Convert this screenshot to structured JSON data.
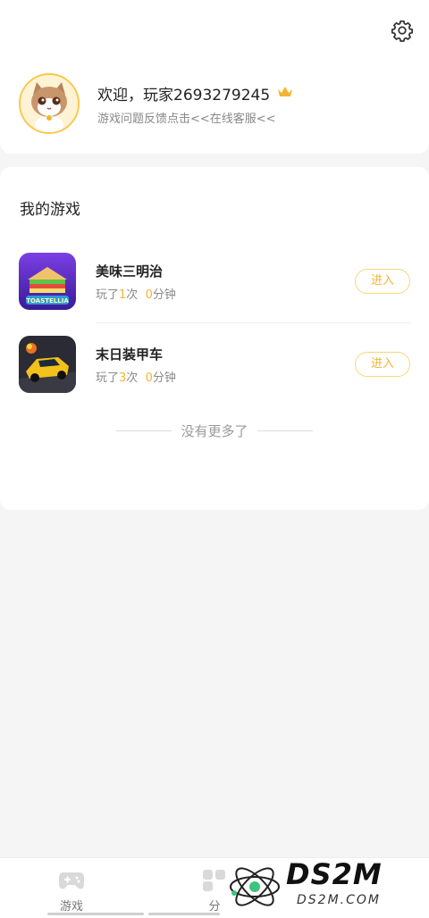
{
  "profile": {
    "welcome": "欢迎，玩家2693279245",
    "feedback": "游戏问题反馈点击<<在线客服<<",
    "icons": {
      "settings": "gear-icon",
      "vip": "crown-icon"
    }
  },
  "games_section": {
    "title": "我的游戏",
    "items": [
      {
        "name": "美味三明治",
        "prefix": "玩了",
        "times": "1",
        "times_unit": "次",
        "minutes": "0",
        "minutes_unit": "分钟",
        "action": "进入",
        "icon_text": "TOASTELLIA"
      },
      {
        "name": "末日装甲车",
        "prefix": "玩了",
        "times": "3",
        "times_unit": "次",
        "minutes": "0",
        "minutes_unit": "分钟",
        "action": "进入"
      }
    ],
    "no_more": "没有更多了"
  },
  "tabbar": {
    "tabs": [
      {
        "label": "游戏"
      },
      {
        "label": "分"
      }
    ]
  },
  "watermark": {
    "main": "DS2M",
    "sub": "DS2M.COM"
  },
  "colors": {
    "accent": "#f5b431",
    "button_border": "#f7d77a"
  }
}
